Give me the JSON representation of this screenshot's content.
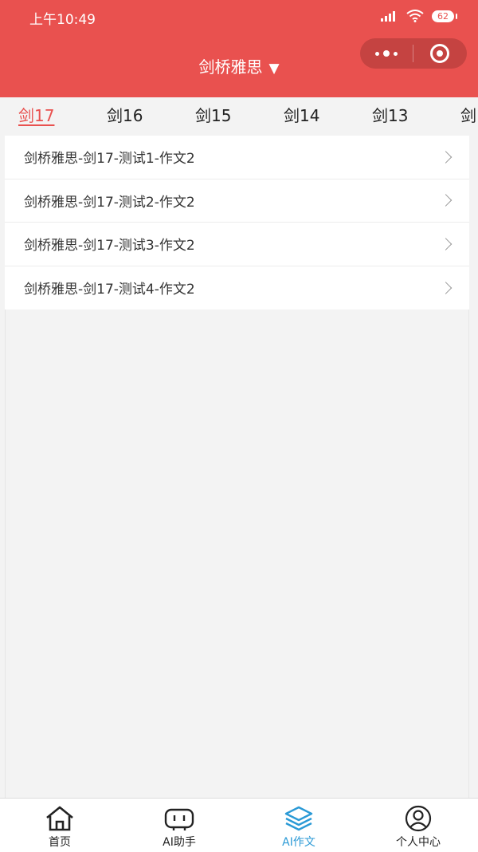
{
  "status_bar": {
    "time": "上午10:49",
    "battery": "62"
  },
  "nav": {
    "title": "剑桥雅思",
    "caret": "▼"
  },
  "tabs": [
    {
      "label": "剑17",
      "active": true
    },
    {
      "label": "剑16"
    },
    {
      "label": "剑15"
    },
    {
      "label": "剑14"
    },
    {
      "label": "剑13"
    },
    {
      "label": "剑"
    }
  ],
  "list": [
    {
      "label": "剑桥雅思-剑17-测试1-作文2"
    },
    {
      "label": "剑桥雅思-剑17-测试2-作文2"
    },
    {
      "label": "剑桥雅思-剑17-测试3-作文2"
    },
    {
      "label": "剑桥雅思-剑17-测试4-作文2"
    }
  ],
  "tabbar": [
    {
      "label": "首页",
      "icon": "home-icon"
    },
    {
      "label": "AI助手",
      "icon": "robot-icon"
    },
    {
      "label": "AI作文",
      "icon": "layers-icon",
      "active": true
    },
    {
      "label": "个人中心",
      "icon": "user-icon"
    }
  ],
  "colors": {
    "accent": "#e9514f",
    "active_tab": "#2b9ad6"
  }
}
